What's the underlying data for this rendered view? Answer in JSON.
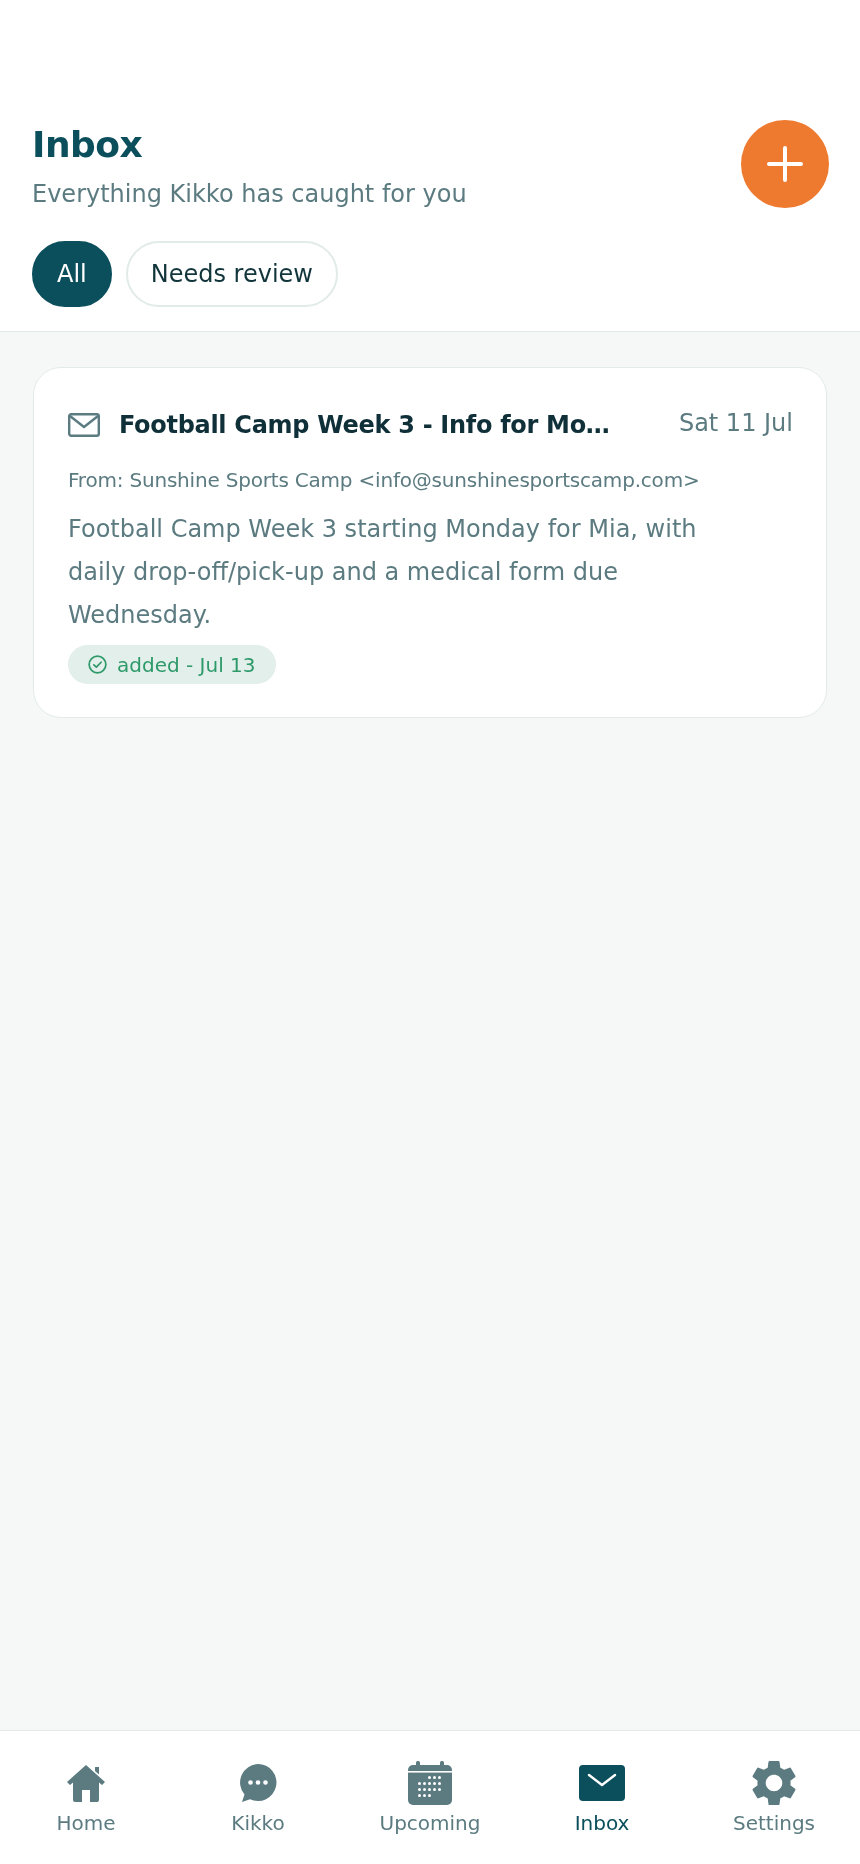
{
  "header": {
    "title": "Inbox",
    "subtitle": "Everything Kikko has caught for you"
  },
  "filters": [
    {
      "label": "All",
      "selected": true
    },
    {
      "label": "Needs review",
      "selected": false
    }
  ],
  "messages": [
    {
      "subject": "Football Camp Week 3 - Info for Mo…",
      "date": "Sat 11 Jul",
      "from": "From: Sunshine Sports Camp <info@sunshinesportscamp.com>",
      "summary": "Football Camp Week 3 starting Monday for Mia, with daily drop-off/pick-up and a medical form due Wednesday.",
      "status": {
        "kind": "added",
        "label": "added - Jul 13"
      }
    }
  ],
  "nav": [
    {
      "label": "Home",
      "selected": false
    },
    {
      "label": "Kikko",
      "selected": false
    },
    {
      "label": "Upcoming",
      "selected": false
    },
    {
      "label": "Inbox",
      "selected": true
    },
    {
      "label": "Settings",
      "selected": false
    }
  ]
}
